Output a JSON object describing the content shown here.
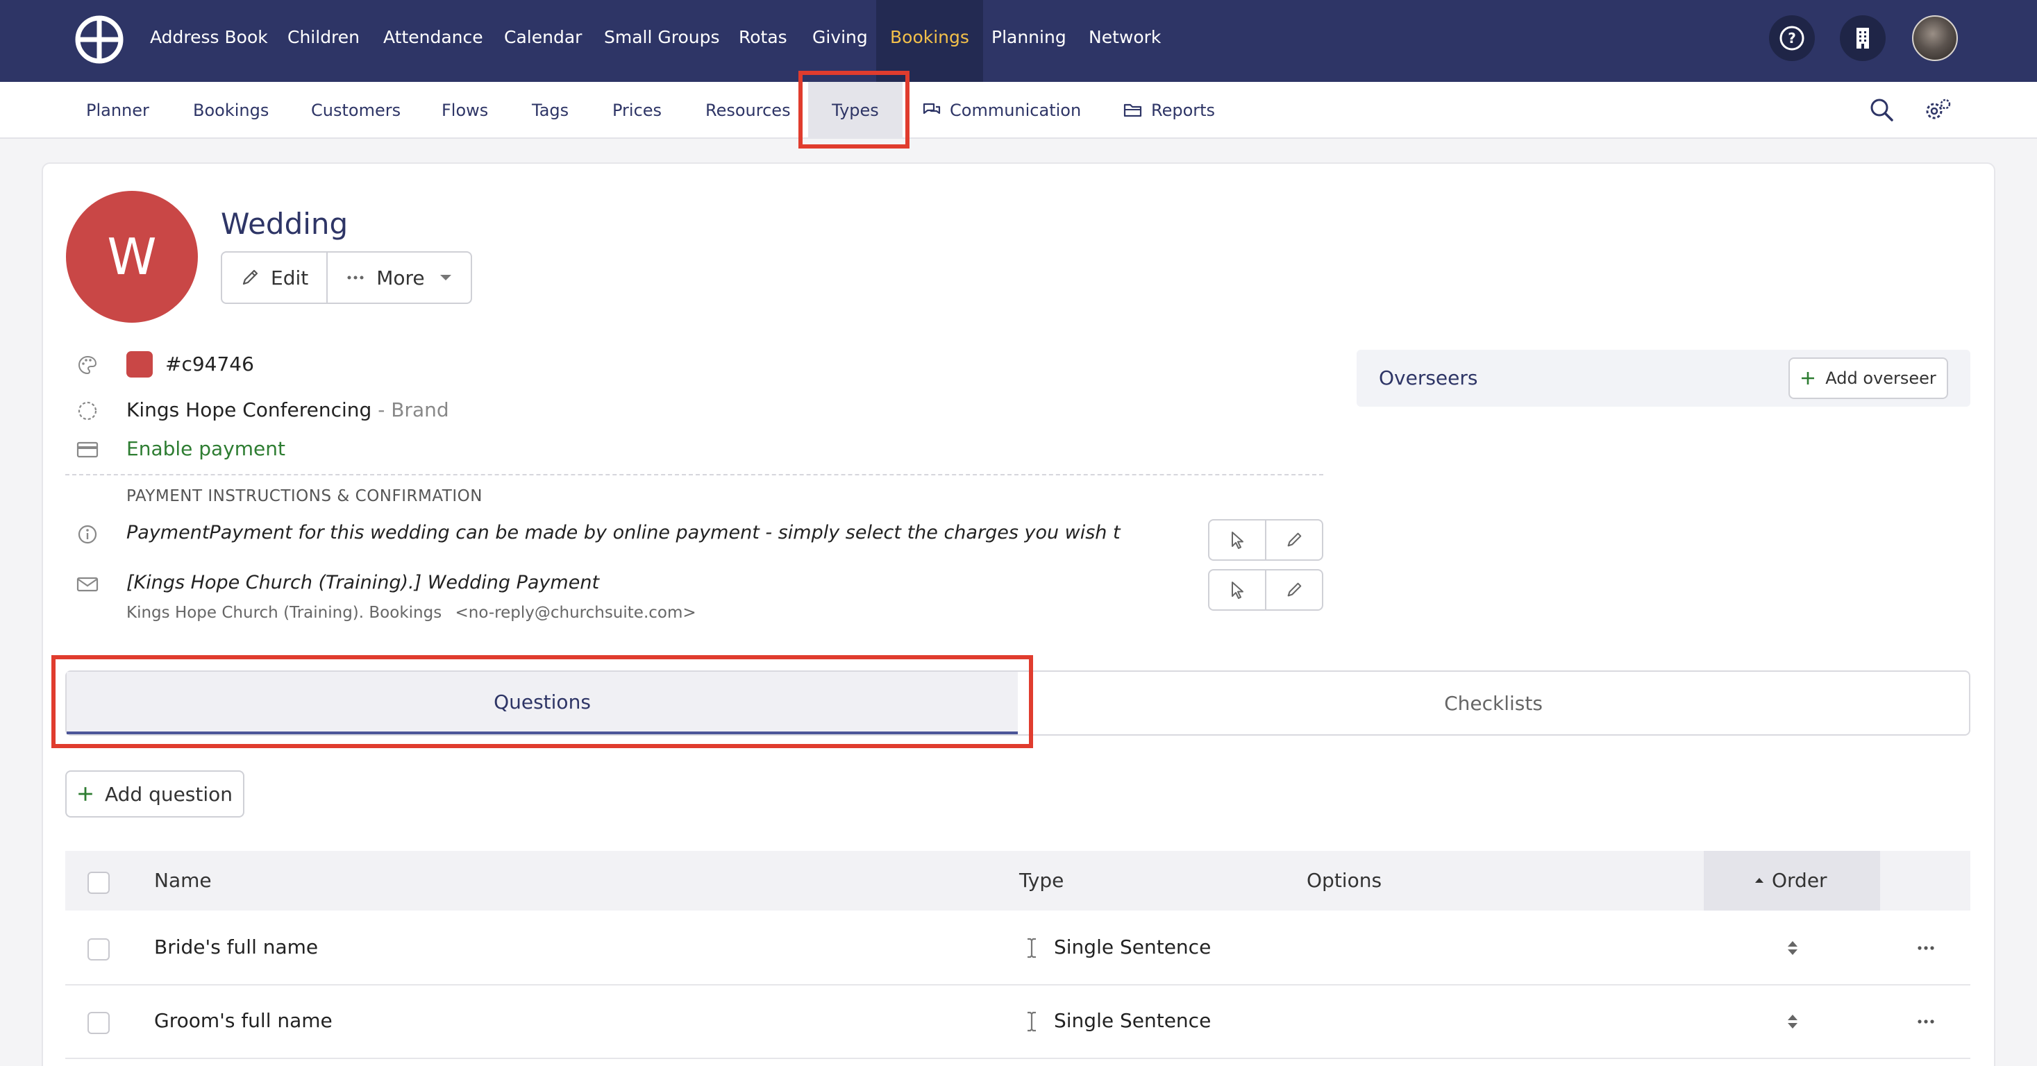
{
  "topnav": {
    "items": [
      "Address Book",
      "Children",
      "Attendance",
      "Calendar",
      "Small Groups",
      "Rotas",
      "Giving",
      "Bookings",
      "Planning",
      "Network"
    ],
    "active": "Bookings"
  },
  "subnav": {
    "items": [
      "Planner",
      "Bookings",
      "Customers",
      "Flows",
      "Tags",
      "Prices",
      "Resources",
      "Types",
      "Communication",
      "Reports"
    ],
    "active": "Types"
  },
  "booking_type": {
    "avatar_letter": "W",
    "title": "Wedding",
    "edit_label": "Edit",
    "more_label": "More",
    "color_value": "#c94746",
    "brand_name": "Kings Hope Conferencing",
    "brand_suffix": "- Brand",
    "enable_payment": "Enable payment"
  },
  "payment": {
    "section_heading": "PAYMENT INSTRUCTIONS & CONFIRMATION",
    "instructions": "PaymentPayment for this wedding can be made by online payment - simply select the charges you wish t",
    "email_subject": "[Kings Hope Church (Training).] Wedding Payment",
    "email_from_name": "Kings Hope Church (Training). Bookings",
    "email_from_address": "<no-reply@churchsuite.com>"
  },
  "overseers": {
    "label": "Overseers",
    "add_label": "Add overseer"
  },
  "tabs": {
    "questions": "Questions",
    "checklists": "Checklists"
  },
  "questions": {
    "add_label": "Add question",
    "columns": {
      "name": "Name",
      "type": "Type",
      "options": "Options",
      "order": "Order"
    },
    "rows": [
      {
        "name": "Bride's full name",
        "type": "Single Sentence"
      },
      {
        "name": "Groom's full name",
        "type": "Single Sentence"
      }
    ]
  },
  "colors": {
    "topbar": "#2e3566",
    "active_nav_text": "#f3c04a",
    "accent": "#c94746",
    "highlight": "#e03c2e",
    "success": "#2e7d32"
  },
  "icons": [
    "app-logo-icon",
    "help-icon",
    "building-icon",
    "search-icon",
    "settings-icon",
    "chat-icon",
    "folder-icon",
    "pencil-icon",
    "ellipsis-icon",
    "caret-down-icon",
    "palette-icon",
    "circle-dashed-icon",
    "credit-card-icon",
    "info-icon",
    "mail-icon",
    "cursor-icon",
    "plus-icon",
    "text-cursor-icon",
    "sort-icon",
    "sort-asc-icon"
  ]
}
